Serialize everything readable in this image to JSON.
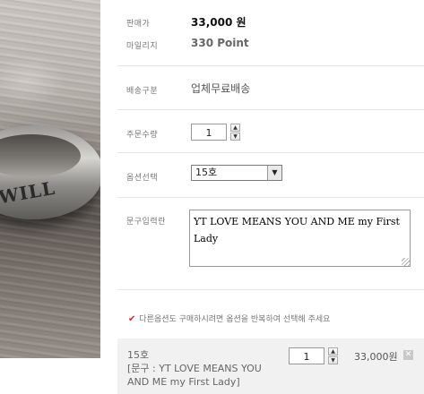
{
  "product": {
    "price_label": "판매가",
    "price": "33,000 원",
    "mileage_label": "마일리지",
    "mileage": "330  Point",
    "shipping_label": "배송구분",
    "shipping": "업체무료배송",
    "quantity_label": "주문수량",
    "quantity": "1",
    "option_label": "옵션선택",
    "option_selected": "15호",
    "engraving_label": "문구입력란",
    "engraving_text": "YT LOVE MEANS YOU AND ME my First Lady"
  },
  "photo": {
    "ring_text": "WILL"
  },
  "notice": {
    "icon": "check-icon",
    "text": "다른옵션도 구매하시려면 옵션을 반복하여 선택해 주세요"
  },
  "selected_option": {
    "line1": "15호",
    "line2": "[문구 : YT LOVE MEANS YOU AND ME my First Lady]",
    "quantity": "1",
    "price": "33,000원",
    "remove_symbol": "✕"
  },
  "colors": {
    "check": "#c6282b",
    "selected_bg": "#f1f1f1",
    "divider": "#e4e4e4"
  }
}
